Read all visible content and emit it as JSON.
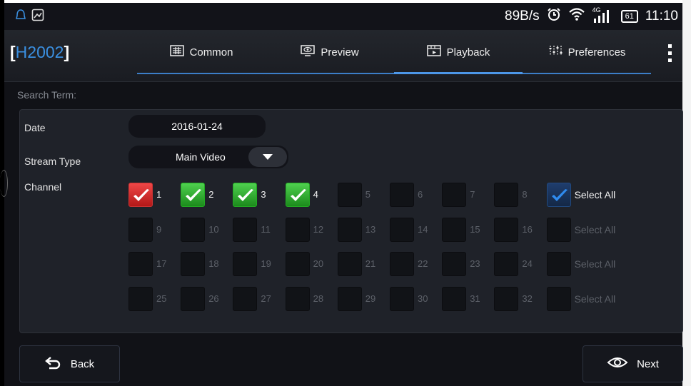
{
  "status_bar": {
    "speed": "89B/s",
    "network": "4G",
    "battery": "61",
    "time": "11:10",
    "left_icons": [
      "notification-icon",
      "image-icon"
    ],
    "right_icons": [
      "alarm-icon",
      "wifi-icon",
      "signal-icon",
      "battery-icon"
    ]
  },
  "header": {
    "device_name": "H2002",
    "bracket_open": "[",
    "bracket_close": "]",
    "tabs": [
      {
        "label": "Common",
        "icon": "table-icon",
        "active": false
      },
      {
        "label": "Preview",
        "icon": "eye-icon",
        "active": false
      },
      {
        "label": "Playback",
        "icon": "film-icon",
        "active": true
      },
      {
        "label": "Preferences",
        "icon": "sliders-icon",
        "active": false
      }
    ],
    "menu_icon": "more-vert-icon"
  },
  "search": {
    "title": "Search Term:",
    "date_label": "Date",
    "date_value": "2016-01-24",
    "stream_label": "Stream Type",
    "stream_value": "Main Video",
    "channel_label": "Channel"
  },
  "channels": {
    "rows": [
      {
        "items": [
          {
            "n": "1",
            "state": "red"
          },
          {
            "n": "2",
            "state": "green"
          },
          {
            "n": "3",
            "state": "green"
          },
          {
            "n": "4",
            "state": "green"
          },
          {
            "n": "5",
            "state": "off"
          },
          {
            "n": "6",
            "state": "off"
          },
          {
            "n": "7",
            "state": "off"
          },
          {
            "n": "8",
            "state": "off"
          }
        ],
        "select_all": {
          "label": "Select All",
          "checked": true
        }
      },
      {
        "items": [
          {
            "n": "9",
            "state": "off"
          },
          {
            "n": "10",
            "state": "off"
          },
          {
            "n": "11",
            "state": "off"
          },
          {
            "n": "12",
            "state": "off"
          },
          {
            "n": "13",
            "state": "off"
          },
          {
            "n": "14",
            "state": "off"
          },
          {
            "n": "15",
            "state": "off"
          },
          {
            "n": "16",
            "state": "off"
          }
        ],
        "select_all": {
          "label": "Select All",
          "checked": false
        }
      },
      {
        "items": [
          {
            "n": "17",
            "state": "off"
          },
          {
            "n": "18",
            "state": "off"
          },
          {
            "n": "19",
            "state": "off"
          },
          {
            "n": "20",
            "state": "off"
          },
          {
            "n": "21",
            "state": "off"
          },
          {
            "n": "22",
            "state": "off"
          },
          {
            "n": "23",
            "state": "off"
          },
          {
            "n": "24",
            "state": "off"
          }
        ],
        "select_all": {
          "label": "Select All",
          "checked": false
        }
      },
      {
        "items": [
          {
            "n": "25",
            "state": "off"
          },
          {
            "n": "26",
            "state": "off"
          },
          {
            "n": "27",
            "state": "off"
          },
          {
            "n": "28",
            "state": "off"
          },
          {
            "n": "29",
            "state": "off"
          },
          {
            "n": "30",
            "state": "off"
          },
          {
            "n": "31",
            "state": "off"
          },
          {
            "n": "32",
            "state": "off"
          }
        ],
        "select_all": {
          "label": "Select All",
          "checked": false
        }
      }
    ]
  },
  "footer": {
    "back_label": "Back",
    "next_label": "Next"
  },
  "colors": {
    "accent": "#4d97e8",
    "device": "#3a8fe0",
    "checked_red": "#d92f2f",
    "checked_green": "#2fb52f",
    "select_all_check": "#2f8bef"
  }
}
